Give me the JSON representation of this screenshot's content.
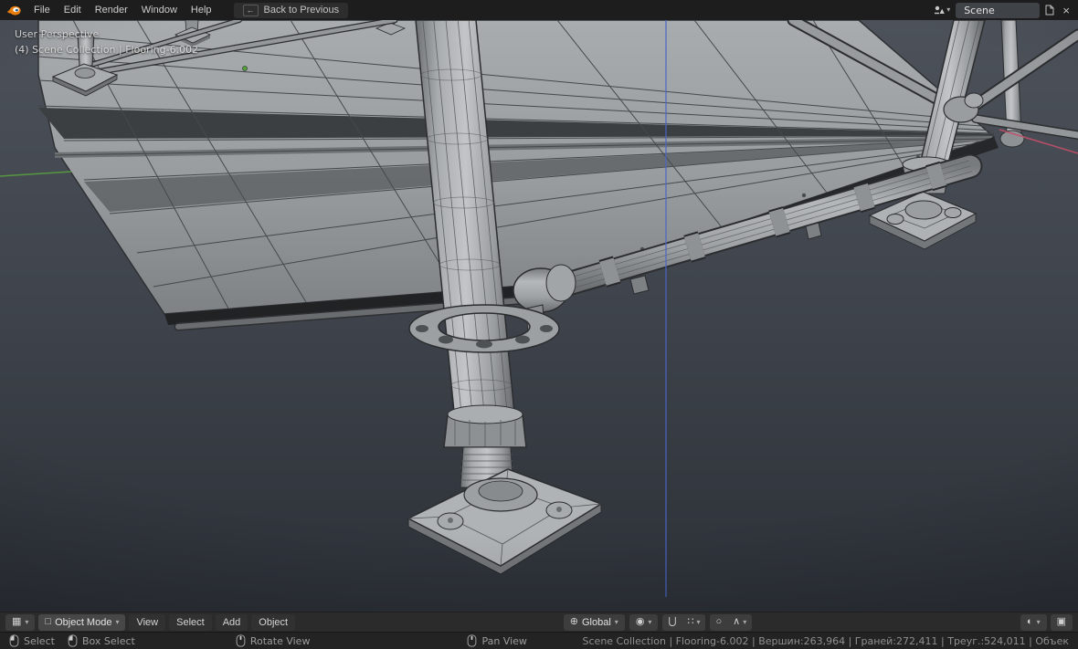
{
  "colors": {
    "viewport_gradient_top": "#4d525a",
    "viewport_gradient_bottom": "#2c3037",
    "axis_x": "#c0506a",
    "axis_y": "#59a03f",
    "axis_z": "#4a66c8",
    "origin_dot": "#55a33c",
    "accent_orange": "#e87d0d",
    "wireframe_gray": "#9da0a3"
  },
  "glyphs": {
    "dropdown": "▾",
    "back": "←",
    "editor": "▦",
    "mode": "□",
    "orientation": "⊕",
    "pivot": "◉",
    "magnet": "⋃",
    "snap_grid": "∷",
    "proportional": "○",
    "falloff": "∧",
    "shading": "◐",
    "overlay": "▣",
    "close": "×"
  },
  "topbar": {
    "menus": [
      "File",
      "Edit",
      "Render",
      "Window",
      "Help"
    ],
    "back_label": "Back to Previous",
    "scene_name": "Scene"
  },
  "viewport": {
    "overlay_line1": "User Perspective",
    "overlay_line2": "(4) Scene Collection | Flooring-6.002"
  },
  "tool_header": {
    "mode_label": "Object Mode",
    "menus": [
      "View",
      "Select",
      "Add",
      "Object"
    ],
    "orientation_label": "Global"
  },
  "status_bar": {
    "hints": [
      "Select",
      "Box Select",
      "Rotate View",
      "Pan View"
    ],
    "stats": "Scene Collection | Flooring-6.002 | Вершин:263,964 | Граней:272,411 | Треуг.:524,011 | Объек"
  }
}
